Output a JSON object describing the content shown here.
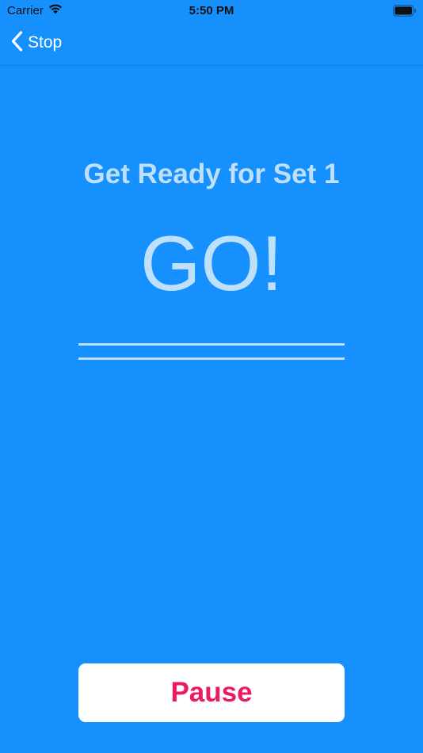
{
  "status_bar": {
    "carrier": "Carrier",
    "time": "5:50 PM",
    "icons": [
      "wifi-icon",
      "battery-icon"
    ]
  },
  "nav": {
    "back_label": "Stop",
    "back_icon": "chevron-left-icon"
  },
  "main": {
    "set_title": "Get Ready for Set 1",
    "countdown": "GO!"
  },
  "controls": {
    "pause_label": "Pause"
  },
  "colors": {
    "background": "#1690fd",
    "text_light": "#bfe0fb",
    "accent": "#ec1b61",
    "button_bg": "#ffffff"
  }
}
